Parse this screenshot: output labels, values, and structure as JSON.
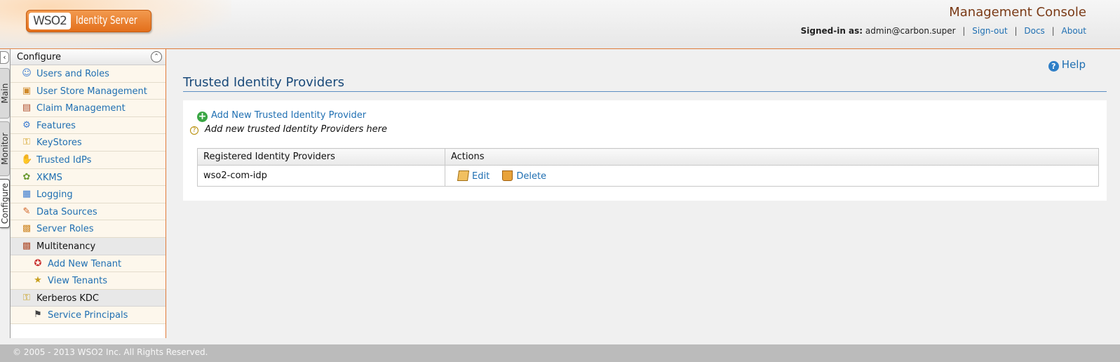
{
  "header": {
    "logo_brand": "WSO2",
    "logo_product": "Identity Server",
    "console_title": "Management Console",
    "signed_in_label": "Signed-in as:",
    "signed_in_user": "admin@carbon.super",
    "links": {
      "signout": "Sign-out",
      "docs": "Docs",
      "about": "About"
    },
    "separator": "|"
  },
  "vertical_tabs": [
    {
      "label": "Main",
      "active": false
    },
    {
      "label": "Monitor",
      "active": false
    },
    {
      "label": "Configure",
      "active": true
    }
  ],
  "sidebar": {
    "title": "Configure",
    "items": [
      {
        "label": "Users and Roles",
        "icon": "users-roles-icon",
        "level": 1
      },
      {
        "label": "User Store Management",
        "icon": "userstore-icon",
        "level": 1
      },
      {
        "label": "Claim Management",
        "icon": "claim-icon",
        "level": 1
      },
      {
        "label": "Features",
        "icon": "features-icon",
        "level": 1
      },
      {
        "label": "KeyStores",
        "icon": "key-icon",
        "level": 1
      },
      {
        "label": "Trusted IdPs",
        "icon": "handshake-icon",
        "level": 1
      },
      {
        "label": "XKMS",
        "icon": "xkms-icon",
        "level": 1
      },
      {
        "label": "Logging",
        "icon": "logging-icon",
        "level": 1
      },
      {
        "label": "Data Sources",
        "icon": "datasource-icon",
        "level": 1
      },
      {
        "label": "Server Roles",
        "icon": "server-roles-icon",
        "level": 1
      },
      {
        "label": "Multitenancy",
        "icon": "multitenancy-icon",
        "level": 1,
        "group": true
      },
      {
        "label": "Add New Tenant",
        "icon": "add-tenant-icon",
        "level": 2
      },
      {
        "label": "View Tenants",
        "icon": "view-tenants-icon",
        "level": 2
      },
      {
        "label": "Kerberos KDC",
        "icon": "kerberos-icon",
        "level": 1,
        "group": true
      },
      {
        "label": "Service Principals",
        "icon": "service-principal-icon",
        "level": 2
      }
    ]
  },
  "main": {
    "help_label": "Help",
    "page_title": "Trusted Identity Providers",
    "add_link": "Add New Trusted Identity Provider",
    "add_hint": "Add new trusted Identity Providers here",
    "table": {
      "headers": [
        "Registered Identity Providers",
        "Actions"
      ],
      "rows": [
        {
          "name": "wso2-com-idp",
          "edit": "Edit",
          "delete": "Delete"
        }
      ]
    }
  },
  "footer": {
    "copyright": "© 2005 - 2013 WSO2 Inc. All Rights Reserved."
  },
  "colors": {
    "accent": "#e07b3a",
    "link": "#1f6fb2",
    "title": "#1a4a7a",
    "console_title": "#7a3a16"
  }
}
